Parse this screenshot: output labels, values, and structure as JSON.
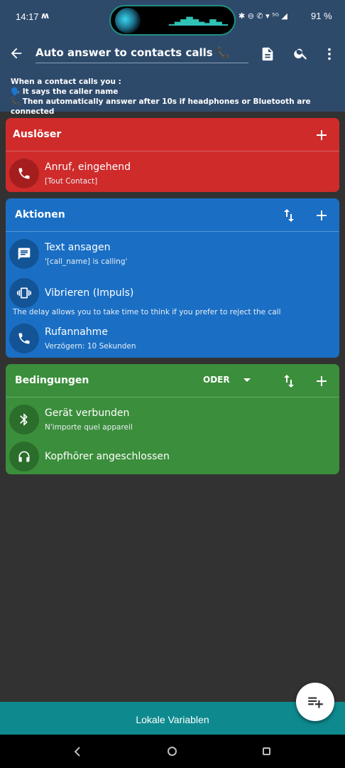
{
  "status": {
    "time": "14:17",
    "mode_glyph": "ʍ",
    "icons": "✱ ⊖ ✆ ▾ ⁵ᴳ ◢",
    "battery": "91 %"
  },
  "appbar": {
    "title": "Auto answer to contacts calls 📞",
    "description_line1": "When a contact calls you :",
    "description_line2": "🗣️ It says the caller name",
    "description_line3": "📞 Then automatically answer after 10s if headphones or Bluetooth are connected"
  },
  "triggers": {
    "title": "Auslöser",
    "items": [
      {
        "title": "Anruf, eingehend",
        "subtitle": "[Tout Contact]",
        "icon": "phone-icon"
      }
    ]
  },
  "actions": {
    "title": "Aktionen",
    "items": [
      {
        "title": "Text ansagen",
        "subtitle": "'[call_name] is calling'",
        "icon": "message-icon"
      },
      {
        "title": "Vibrieren (Impuls)",
        "subtitle": "",
        "icon": "vibrate-icon"
      },
      {
        "title": "Rufannahme",
        "subtitle": "Verzögern: 10 Sekunden",
        "icon": "phone-icon"
      }
    ],
    "note": "The delay allows you to take time to think if you prefer to reject the call"
  },
  "conditions": {
    "title": "Bedingungen",
    "logic": "ODER",
    "items": [
      {
        "title": "Gerät verbunden",
        "subtitle": "N'importe quel appareil",
        "icon": "bluetooth-icon"
      },
      {
        "title": "Kopfhörer angeschlossen",
        "subtitle": "",
        "icon": "headphones-icon"
      }
    ]
  },
  "bottom": {
    "label": "Lokale Variablen"
  },
  "colors": {
    "header": "#2e4a6b",
    "triggers": "#cf2b2b",
    "actions": "#1a6fc4",
    "conditions": "#3b8e3b",
    "bottom_bar": "#0e8a8f"
  }
}
